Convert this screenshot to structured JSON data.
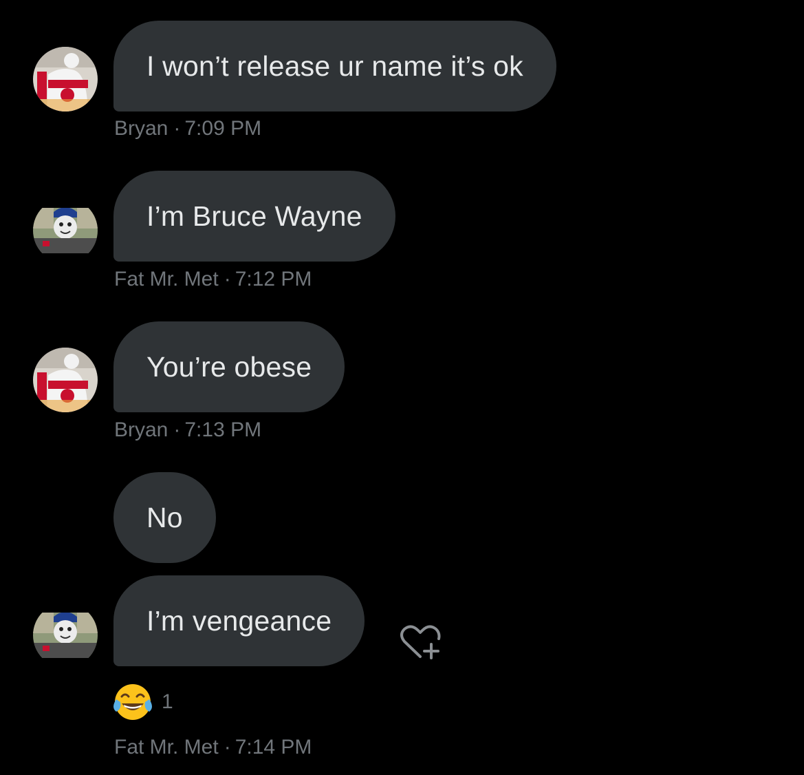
{
  "conversation": {
    "messages": [
      {
        "sender": "Bryan",
        "time": "7:09 PM",
        "text": "I won’t release ur name it’s ok"
      },
      {
        "sender": "Fat Mr. Met",
        "time": "7:12 PM",
        "text": "I’m Bruce Wayne"
      },
      {
        "sender": "Bryan",
        "time": "7:13 PM",
        "text": "You’re obese"
      },
      {
        "sender": "Fat Mr. Met",
        "time": "",
        "text": "No"
      },
      {
        "sender": "Fat Mr. Met",
        "time": "7:14 PM",
        "text": "I’m vengeance"
      }
    ],
    "meta_separator": "·",
    "reaction": {
      "emoji": "tears-of-joy-emoji",
      "count": "1"
    },
    "add_reaction_icon": "heart-plus-icon"
  },
  "colors": {
    "background": "#000000",
    "bubble": "#2f3336",
    "text": "#e7e9ea",
    "meta_text": "#71767b"
  }
}
